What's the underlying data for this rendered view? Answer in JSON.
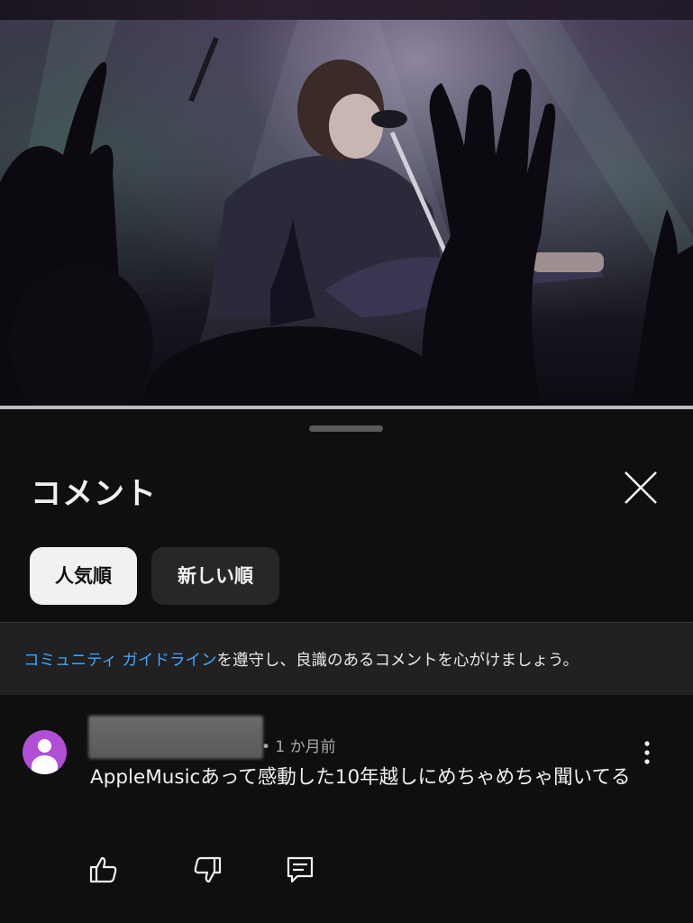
{
  "player": {
    "progress_percent": 100
  },
  "sheet": {
    "title": "コメント",
    "close_icon": "close-icon",
    "sort_chips": [
      {
        "label": "人気順",
        "selected": true
      },
      {
        "label": "新しい順",
        "selected": false
      }
    ]
  },
  "guideline": {
    "link_text": "コミュニティ ガイドライン",
    "text": "を遵守し、良識のあるコメントを心がけましょう。"
  },
  "comment": {
    "time": "• 1 か月前",
    "text": "AppleMusicあって感動した10年越しにめちゃめちゃ聞いてる",
    "avatar_color": "#b04fd6",
    "actions": [
      "like-icon",
      "dislike-icon",
      "reply-icon"
    ],
    "menu_icon": "more-vertical-icon"
  },
  "colors": {
    "background": "#0f0f0f",
    "link": "#3ea6ff",
    "chip_active": "#f1f1f1",
    "chip_inactive": "#272727"
  }
}
